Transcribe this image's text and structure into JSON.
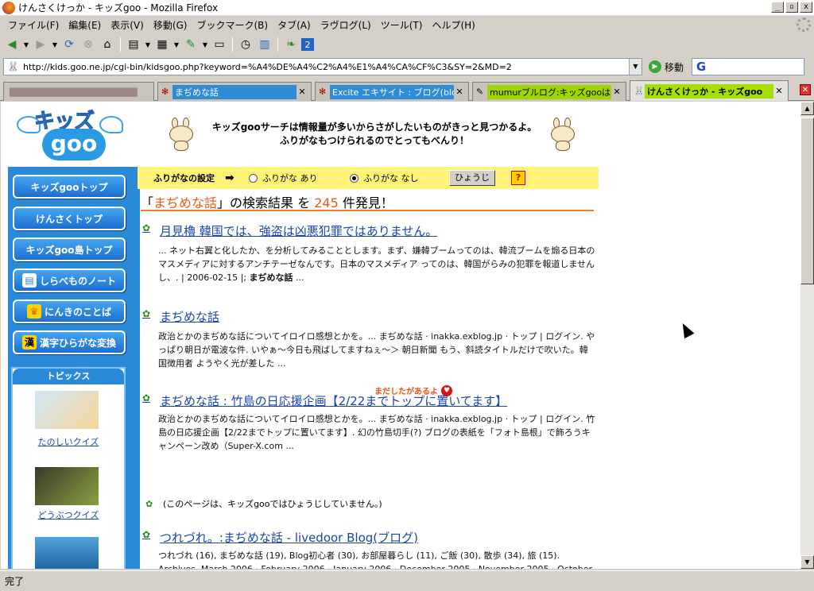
{
  "window": {
    "title": "けんさくけっか - キッズgoo - Mozilla Firefox",
    "buttons": [
      "_",
      "▫",
      "x"
    ]
  },
  "menu": [
    "ファイル(F)",
    "編集(E)",
    "表示(V)",
    "移動(G)",
    "ブックマーク(B)",
    "タブ(A)",
    "ラヴログ(L)",
    "ツール(T)",
    "ヘルプ(H)"
  ],
  "toolbar": {
    "icons": [
      "back-icon",
      "forward-icon",
      "reload-icon",
      "stop-icon",
      "home-icon",
      "print-icon",
      "bookmark-icon",
      "history-icon",
      "clock-icon",
      "book-icon",
      "leaf-icon",
      "number-icon"
    ]
  },
  "urlbar": {
    "url": "http://kids.goo.ne.jp/cgi-bin/kidsgoo.php?keyword=%A4%DE%A4%C2%A4%E1%A4%CA%CF%C3&SY=2&MD=2",
    "go_label": "移動",
    "search_engine": "G"
  },
  "tabs": [
    {
      "label": "▇▇▇▇▇▇▇▇▇▇▇▇▇▇▇▇▇▇▇"
    },
    {
      "label": "まぢめな話"
    },
    {
      "label": "Excite エキサイト : ブログ(blo..."
    },
    {
      "label": "mumurブルログ:キッズgooはあ..."
    },
    {
      "label": "けんさくけっか - キッズgoo"
    }
  ],
  "header": {
    "logo_top": "キッズ",
    "logo_bottom": "goo",
    "banner_line1": "キッズgooサーチは情報量が多いからさがしたいものがきっと見つかるよ。",
    "banner_line2": "ふりがなもつけられるのでとってもべんり！"
  },
  "sidebar": {
    "buttons": [
      "キッズgooトップ",
      "けんさくトップ",
      "キッズgoo島トップ",
      "しらべものノート",
      "にんきのことば",
      "漢字ひらがな変換"
    ],
    "topics_title": "トピックス",
    "topics": [
      "たのしいクイズ",
      "どうぶつクイズ"
    ]
  },
  "furigana": {
    "label": "ふりがなの設定",
    "option_on": "ふりがな あり",
    "option_off": "ふりがな なし",
    "selected": "ふりがな なし",
    "display_button": "ひょうじ",
    "help": "?"
  },
  "results_header": {
    "open_quote": "「",
    "keyword": "まぢめな話",
    "middle": "」の検索結果 を",
    "count": "245",
    "suffix": "件発見！"
  },
  "results": [
    {
      "title": "月見櫓 韓国では、強盗は凶悪犯罪ではありません。",
      "snippet_pre": "... ネット右翼と化したか、を分析してみることとします。まず、嫌韓ブームってのは、韓流ブームを煽る日本のマスメディアに対するアンチテーゼなんです。日本のマスメディア ってのは、韓国がらみの犯罪を報道しませんし、. | 2006-02-15 |; ",
      "snippet_bold": "まぢめな話",
      "snippet_post": " ..."
    },
    {
      "title": "まぢめな話",
      "snippet": "政治とかのまぢめな話についてイロイロ感想とかを。... まぢめな話 · inakka.exblog.jp · トップ | ログイン. やっぱり朝日が電波な件. いやぁ〜今日も飛ばしてますねぇ〜＞ 朝日新聞 もう、斜読タイトルだけで吹いた。韓国徴用者 ようやく光が差した ..."
    },
    {
      "title": "まぢめな話 : 竹島の日応援企画【2/22までトップに置いてます】",
      "snippet": "政治とかのまぢめな話についてイロイロ感想とかを。... まぢめな話 · inakka.exblog.jp · トップ | ログイン. 竹島の日応援企画【2/22までトップに置いてます】. 幻の竹島切手(?) ブログの表紙を「フォト島根」で飾ろうキャンペーン改め（Super-X.com ..."
    },
    {
      "title": "つれづれ。:まぢめな話 - livedoor Blog(ブログ)",
      "snippet": "つれづれ (16), まぢめな話 (19), Blog初心者 (30), お部屋暮らし (11), ご飯 (30), 散歩 (34), 旅 (15). Archives. March 2006 · February 2006 · January 2006 · December 2005 · November 2005 · October ..."
    }
  ],
  "more_note": "まだしたがあるよ",
  "no_display_note": "(このページは、キッズgooではひょうじしていません。)",
  "status": "完了"
}
